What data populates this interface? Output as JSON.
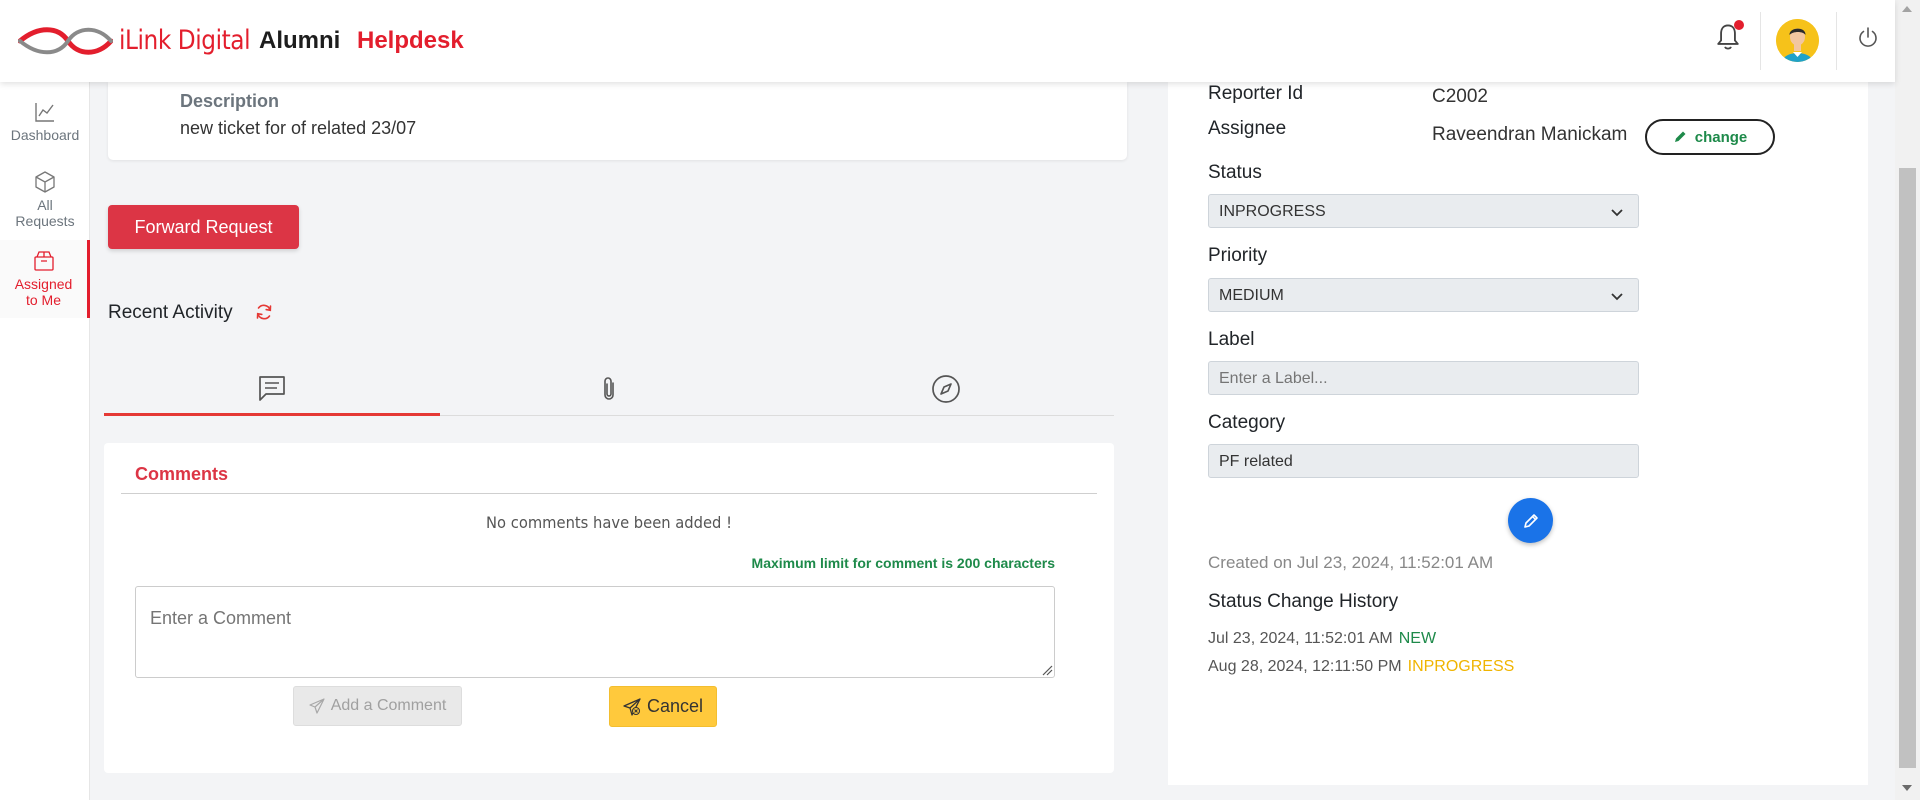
{
  "header": {
    "brand": "iLink Digital",
    "title_alumni": "Alumni",
    "title_helpdesk": "Helpdesk"
  },
  "sidebar": {
    "items": [
      {
        "label": "Dashboard",
        "icon": "line-chart-icon"
      },
      {
        "label_line1": "All",
        "label_line2": "Requests",
        "icon": "box-icon"
      },
      {
        "label_line1": "Assigned",
        "label_line2": "to Me",
        "icon": "package-icon",
        "active": true
      }
    ]
  },
  "description": {
    "label": "Description",
    "value": "new ticket for of related 23/07"
  },
  "forward_button": "Forward Request",
  "recent_activity": {
    "label": "Recent Activity",
    "tabs": [
      {
        "icon": "comment-icon",
        "active": true
      },
      {
        "icon": "paperclip-icon",
        "active": false
      },
      {
        "icon": "compass-icon",
        "active": false
      }
    ]
  },
  "comments": {
    "title": "Comments",
    "empty_message": "No comments have been added !",
    "max_limit": "Maximum limit for comment is 200 characters",
    "input_placeholder": "Enter a Comment",
    "add_button": "Add a Comment",
    "cancel_button": "Cancel"
  },
  "details": {
    "reporter_id_label": "Reporter Id",
    "reporter_id_value": "C2002",
    "assignee_label": "Assignee",
    "assignee_value": "Raveendran Manickam",
    "change_button": "change",
    "status_label": "Status",
    "status_value": "INPROGRESS",
    "priority_label": "Priority",
    "priority_value": "MEDIUM",
    "label_label": "Label",
    "label_placeholder": "Enter a Label...",
    "category_label": "Category",
    "category_value": "PF related",
    "created_on": "Created on Jul 23, 2024, 11:52:01 AM",
    "history_title": "Status Change History",
    "history": [
      {
        "date": "Jul 23, 2024, 11:52:01 AM",
        "status": "NEW",
        "color": "#1e8a4a"
      },
      {
        "date": "Aug 28, 2024, 12:11:50 PM",
        "status": "INPROGRESS",
        "color": "#f0b400"
      }
    ]
  },
  "colors": {
    "brand_red": "#e31e2d",
    "primary_blue": "#1a73e8",
    "success_green": "#1e8a4a",
    "warning_yellow": "#ffc93c"
  }
}
